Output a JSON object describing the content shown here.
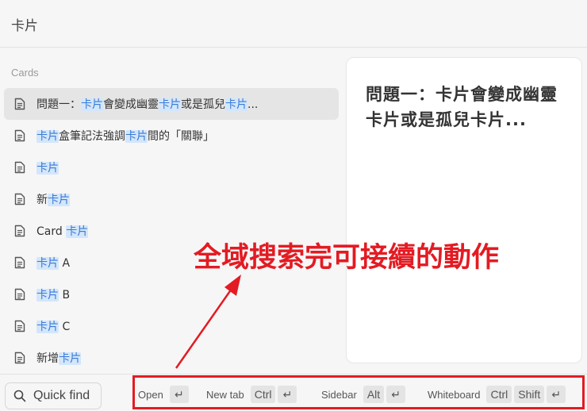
{
  "search": {
    "query": "卡片"
  },
  "section": {
    "label": "Cards"
  },
  "results": [
    {
      "parts": [
        [
          "問題一：",
          false
        ],
        [
          "卡片",
          true
        ],
        [
          "會變成幽靈",
          false
        ],
        [
          "卡片",
          true
        ],
        [
          "或是孤兒",
          false
        ],
        [
          "卡片",
          true
        ],
        [
          "...",
          false
        ]
      ],
      "selected": true
    },
    {
      "parts": [
        [
          "卡片",
          true
        ],
        [
          "盒筆記法強調",
          false
        ],
        [
          "卡片",
          true
        ],
        [
          "間的「關聯」",
          false
        ]
      ]
    },
    {
      "parts": [
        [
          "卡片",
          true
        ]
      ]
    },
    {
      "parts": [
        [
          "新",
          false
        ],
        [
          "卡片",
          true
        ]
      ]
    },
    {
      "parts": [
        [
          "Card ",
          false
        ],
        [
          "卡片",
          true
        ]
      ]
    },
    {
      "parts": [
        [
          "卡片",
          true
        ],
        [
          " A",
          false
        ]
      ]
    },
    {
      "parts": [
        [
          "卡片",
          true
        ],
        [
          " B",
          false
        ]
      ]
    },
    {
      "parts": [
        [
          "卡片",
          true
        ],
        [
          " C",
          false
        ]
      ]
    },
    {
      "parts": [
        [
          "新增",
          false
        ],
        [
          "卡片",
          true
        ]
      ]
    }
  ],
  "preview": {
    "title": "問題一：卡片會變成幽靈卡片或是孤兒卡片..."
  },
  "footer": {
    "quick_find_label": "Quick find",
    "hints": [
      {
        "label": "Open",
        "keys": [
          "↵"
        ]
      },
      {
        "label": "New tab",
        "keys": [
          "Ctrl",
          "↵"
        ]
      },
      {
        "label": "Sidebar",
        "keys": [
          "Alt",
          "↵"
        ]
      },
      {
        "label": "Whiteboard",
        "keys": [
          "Ctrl",
          "Shift",
          "↵"
        ]
      }
    ]
  },
  "annotation": {
    "text": "全域搜索完可接續的動作",
    "color": "#e31b23"
  },
  "colors": {
    "highlight_bg": "#d3e6fb",
    "highlight_text": "#3a7bd5",
    "selected_bg": "#e5e5e5"
  }
}
